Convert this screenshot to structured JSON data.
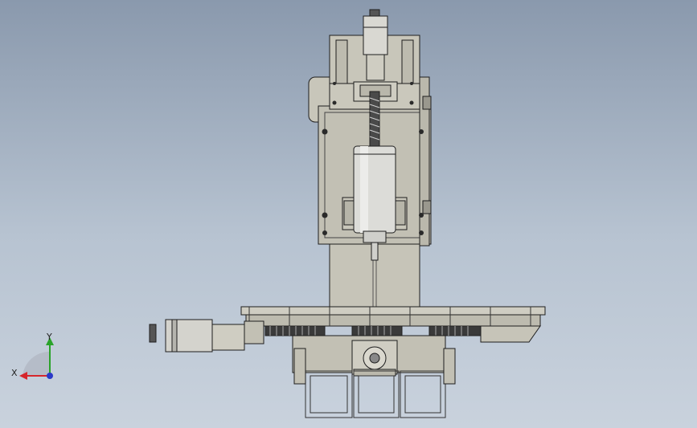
{
  "viewport": {
    "background_top": "#8a99ad",
    "background_bottom": "#c9d2dd"
  },
  "model": {
    "body_color": "#c2c0b4",
    "panel_color": "#cfcdc2",
    "spindle_color": "#d6d6d3",
    "line_color": "#1e1e1e"
  },
  "triad": {
    "x_label": "X",
    "y_label": "Y",
    "x_color": "#d6262c",
    "y_color": "#2aa32a",
    "z_color": "#2a39c8"
  }
}
